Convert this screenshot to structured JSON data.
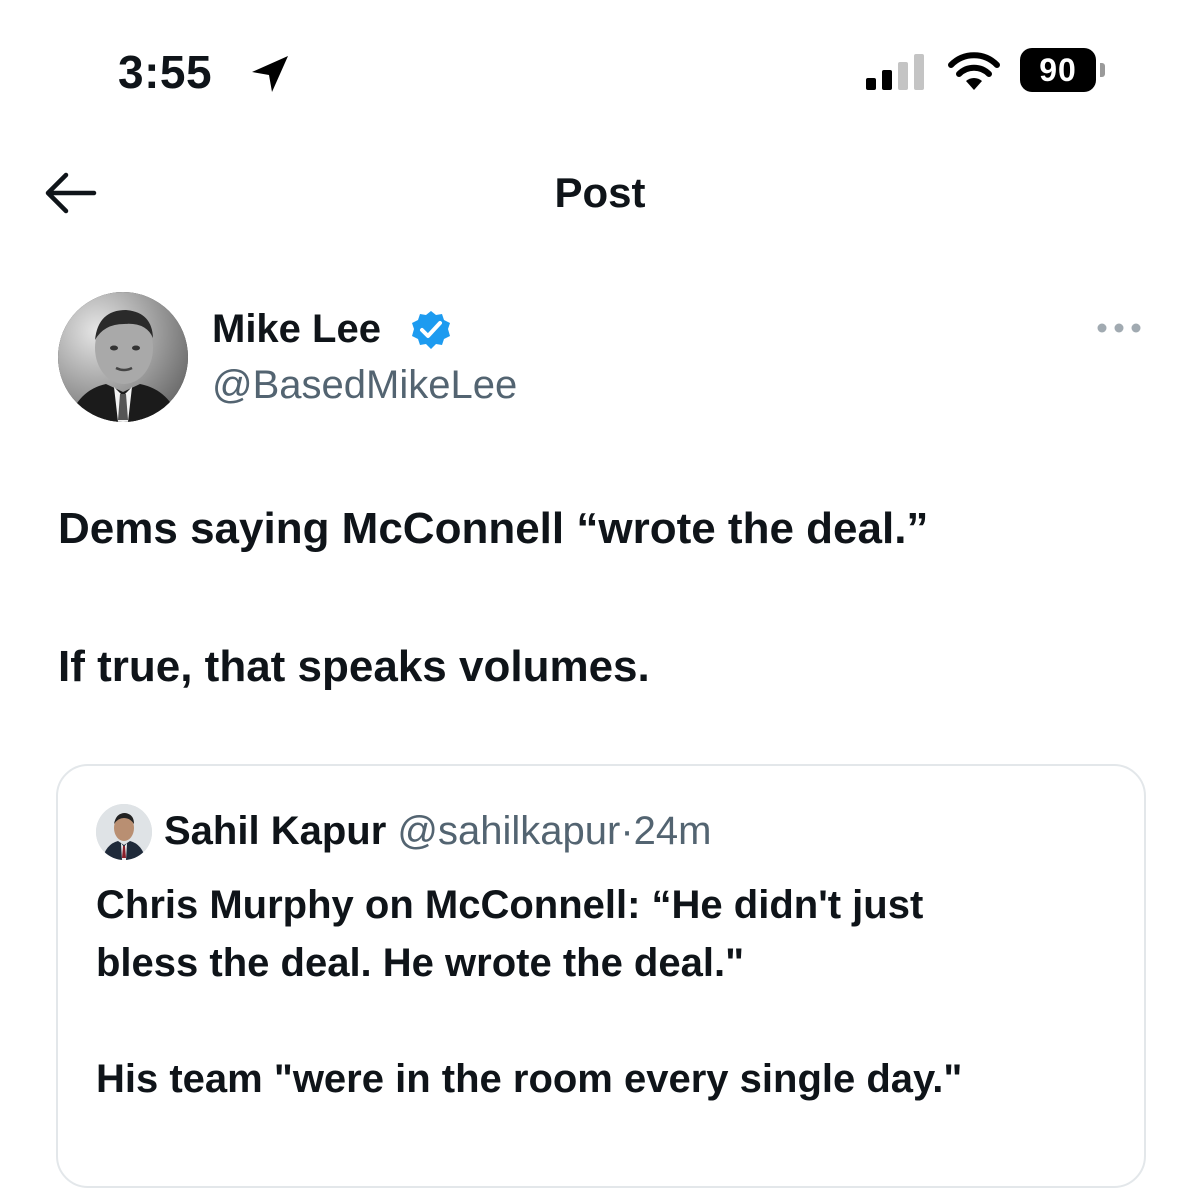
{
  "status_bar": {
    "time": "3:55",
    "battery_level": "90"
  },
  "header": {
    "title": "Post"
  },
  "post": {
    "author_name": "Mike Lee",
    "author_handle": "@BasedMikeLee",
    "text_lines": [
      "Dems saying McConnell “wrote the deal.”",
      "If true, that speaks volumes."
    ],
    "quoted": {
      "author_name": "Sahil Kapur",
      "author_handle": "@sahilkapur",
      "separator": "·",
      "time": "24m",
      "text_lines": [
        "Chris Murphy on McConnell: “He didn't just",
        "bless the deal. He wrote the deal.\"",
        "His team \"were in the room every single day.\""
      ]
    }
  },
  "colors": {
    "verified_badge": "#1d9bf0",
    "secondary_text": "#536471",
    "primary_text": "#0f1419",
    "card_border": "#e3e7ea"
  },
  "icons": [
    "location-arrow-icon",
    "cellular-signal-icon",
    "wifi-icon",
    "battery-icon",
    "back-arrow-icon",
    "verified-badge-icon",
    "more-options-icon"
  ]
}
